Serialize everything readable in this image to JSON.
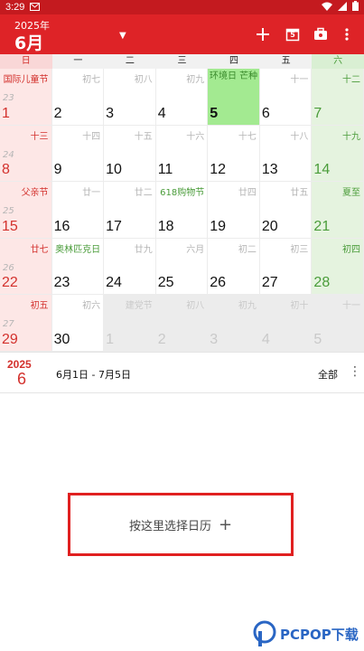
{
  "status_bar": {
    "time": "3:29"
  },
  "app_bar": {
    "year": "2025年",
    "month": "6月",
    "today_badge": "5",
    "accent_color": "#de2327"
  },
  "weekdays": [
    "日",
    "一",
    "二",
    "三",
    "四",
    "五",
    "六"
  ],
  "weeks": [
    {
      "week_no": "23",
      "days": [
        {
          "day": "1",
          "lunar": "国际儿童节",
          "kind": "sun",
          "lunar_style": "festival-red"
        },
        {
          "day": "2",
          "lunar": "初七",
          "kind": "normal",
          "lunar_style": ""
        },
        {
          "day": "3",
          "lunar": "初八",
          "kind": "normal",
          "lunar_style": ""
        },
        {
          "day": "4",
          "lunar": "初九",
          "kind": "normal",
          "lunar_style": ""
        },
        {
          "day": "5",
          "lunar": "环境日 芒种",
          "kind": "today",
          "lunar_style": ""
        },
        {
          "day": "6",
          "lunar": "十一",
          "kind": "normal",
          "lunar_style": ""
        },
        {
          "day": "7",
          "lunar": "十二",
          "kind": "sat",
          "lunar_style": "term"
        }
      ]
    },
    {
      "week_no": "24",
      "days": [
        {
          "day": "8",
          "lunar": "十三",
          "kind": "sun",
          "lunar_style": "festival-red"
        },
        {
          "day": "9",
          "lunar": "十四",
          "kind": "normal",
          "lunar_style": ""
        },
        {
          "day": "10",
          "lunar": "十五",
          "kind": "normal",
          "lunar_style": ""
        },
        {
          "day": "11",
          "lunar": "十六",
          "kind": "normal",
          "lunar_style": ""
        },
        {
          "day": "12",
          "lunar": "十七",
          "kind": "normal",
          "lunar_style": ""
        },
        {
          "day": "13",
          "lunar": "十八",
          "kind": "normal",
          "lunar_style": ""
        },
        {
          "day": "14",
          "lunar": "十九",
          "kind": "sat",
          "lunar_style": "term"
        }
      ]
    },
    {
      "week_no": "25",
      "days": [
        {
          "day": "15",
          "lunar": "父亲节",
          "kind": "sun",
          "lunar_style": "festival-red"
        },
        {
          "day": "16",
          "lunar": "廿一",
          "kind": "normal",
          "lunar_style": ""
        },
        {
          "day": "17",
          "lunar": "廿二",
          "kind": "normal",
          "lunar_style": ""
        },
        {
          "day": "18",
          "lunar": "618购物节",
          "kind": "normal",
          "lunar_style": "festival-green"
        },
        {
          "day": "19",
          "lunar": "廿四",
          "kind": "normal",
          "lunar_style": ""
        },
        {
          "day": "20",
          "lunar": "廿五",
          "kind": "normal",
          "lunar_style": ""
        },
        {
          "day": "21",
          "lunar": "夏至",
          "kind": "sat",
          "lunar_style": "term"
        }
      ]
    },
    {
      "week_no": "26",
      "days": [
        {
          "day": "22",
          "lunar": "廿七",
          "kind": "sun",
          "lunar_style": "festival-red"
        },
        {
          "day": "23",
          "lunar": "奥林匹克日",
          "kind": "normal",
          "lunar_style": "festival-green"
        },
        {
          "day": "24",
          "lunar": "廿九",
          "kind": "normal",
          "lunar_style": ""
        },
        {
          "day": "25",
          "lunar": "六月",
          "kind": "normal",
          "lunar_style": ""
        },
        {
          "day": "26",
          "lunar": "初二",
          "kind": "normal",
          "lunar_style": ""
        },
        {
          "day": "27",
          "lunar": "初三",
          "kind": "normal",
          "lunar_style": ""
        },
        {
          "day": "28",
          "lunar": "初四",
          "kind": "sat",
          "lunar_style": "term"
        }
      ]
    },
    {
      "week_no": "27",
      "days": [
        {
          "day": "29",
          "lunar": "初五",
          "kind": "sun",
          "lunar_style": "festival-red"
        },
        {
          "day": "30",
          "lunar": "初六",
          "kind": "normal",
          "lunar_style": ""
        },
        {
          "day": "1",
          "lunar": "建党节",
          "kind": "next",
          "lunar_style": "festival-green"
        },
        {
          "day": "2",
          "lunar": "初八",
          "kind": "next",
          "lunar_style": ""
        },
        {
          "day": "3",
          "lunar": "初九",
          "kind": "next",
          "lunar_style": ""
        },
        {
          "day": "4",
          "lunar": "初十",
          "kind": "next",
          "lunar_style": ""
        },
        {
          "day": "5",
          "lunar": "十一",
          "kind": "next",
          "lunar_style": ""
        }
      ]
    }
  ],
  "info_bar": {
    "year": "2025",
    "month": "6",
    "range": "6月1日 - 7月5日",
    "filter": "全部"
  },
  "select_calendar": {
    "label": "按这里选择日历",
    "plus": "+"
  },
  "watermark": {
    "text": "PCPOP下载"
  }
}
